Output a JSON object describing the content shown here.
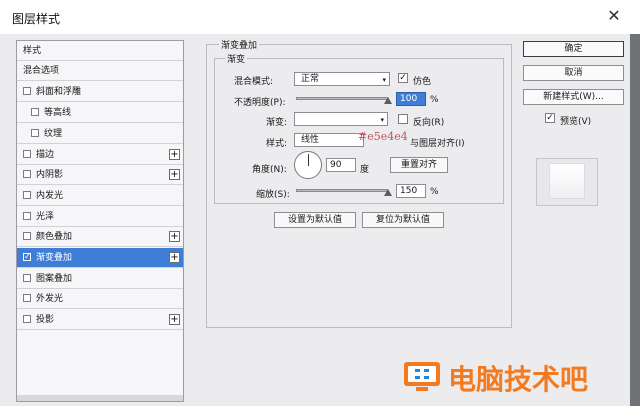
{
  "window": {
    "title": "图层样式",
    "close_glyph": "✕"
  },
  "sidebar": {
    "items": [
      {
        "label": "样式",
        "checkbox": false,
        "plus": false,
        "sub": false,
        "selected": false
      },
      {
        "label": "混合选项",
        "checkbox": false,
        "plus": false,
        "sub": false,
        "selected": false
      },
      {
        "label": "斜面和浮雕",
        "checkbox": true,
        "checked": false,
        "plus": false,
        "sub": false,
        "selected": false
      },
      {
        "label": "等高线",
        "checkbox": true,
        "checked": false,
        "plus": false,
        "sub": true,
        "selected": false
      },
      {
        "label": "纹理",
        "checkbox": true,
        "checked": false,
        "plus": false,
        "sub": true,
        "selected": false
      },
      {
        "label": "描边",
        "checkbox": true,
        "checked": false,
        "plus": true,
        "sub": false,
        "selected": false
      },
      {
        "label": "内阴影",
        "checkbox": true,
        "checked": false,
        "plus": true,
        "sub": false,
        "selected": false
      },
      {
        "label": "内发光",
        "checkbox": true,
        "checked": false,
        "plus": false,
        "sub": false,
        "selected": false
      },
      {
        "label": "光泽",
        "checkbox": true,
        "checked": false,
        "plus": false,
        "sub": false,
        "selected": false
      },
      {
        "label": "颜色叠加",
        "checkbox": true,
        "checked": false,
        "plus": true,
        "sub": false,
        "selected": false
      },
      {
        "label": "渐变叠加",
        "checkbox": true,
        "checked": true,
        "plus": true,
        "sub": false,
        "selected": true
      },
      {
        "label": "图案叠加",
        "checkbox": true,
        "checked": false,
        "plus": false,
        "sub": false,
        "selected": false
      },
      {
        "label": "外发光",
        "checkbox": true,
        "checked": false,
        "plus": false,
        "sub": false,
        "selected": false
      },
      {
        "label": "投影",
        "checkbox": true,
        "checked": false,
        "plus": true,
        "sub": false,
        "selected": false
      }
    ],
    "plus_glyph": "+",
    "check_glyph": "✓"
  },
  "panel": {
    "group_title": "渐变叠加",
    "sub_title": "渐变",
    "blend_mode_label": "混合模式:",
    "blend_mode_value": "正常",
    "dither_label": "仿色",
    "dither_checked": true,
    "opacity_label": "不透明度(P):",
    "opacity_value": "100",
    "opacity_percent": 100,
    "percent_sign": "%",
    "gradient_label": "渐变:",
    "reverse_label": "反向(R)",
    "reverse_checked": false,
    "style_label": "样式:",
    "style_value": "线性",
    "align_layer_label": "与图层对齐(I)",
    "align_layer_checked": true,
    "tooltip_text": "#e5e4e4",
    "angle_label": "角度(N):",
    "angle_value": "90",
    "angle_unit": "度",
    "reset_align_button": "重置对齐",
    "scale_label": "缩放(S):",
    "scale_value": "150",
    "scale_percent": 150,
    "set_default_button": "设置为默认值",
    "reset_default_button": "复位为默认值"
  },
  "actions": {
    "ok_button": "确定",
    "cancel_button": "取消",
    "new_style_button": "新建样式(W)...",
    "preview_label": "预览(V)",
    "preview_checked": true
  },
  "watermark": {
    "text": "电脑技术吧",
    "color": "#f47a1f"
  },
  "colors": {
    "selection": "#3e7ed6",
    "dialog_bg": "#ecebee"
  },
  "icons": {
    "close": "close-icon",
    "dropdown": "chevron-down-icon",
    "check": "check-icon"
  },
  "arrow_glyph": "▾"
}
